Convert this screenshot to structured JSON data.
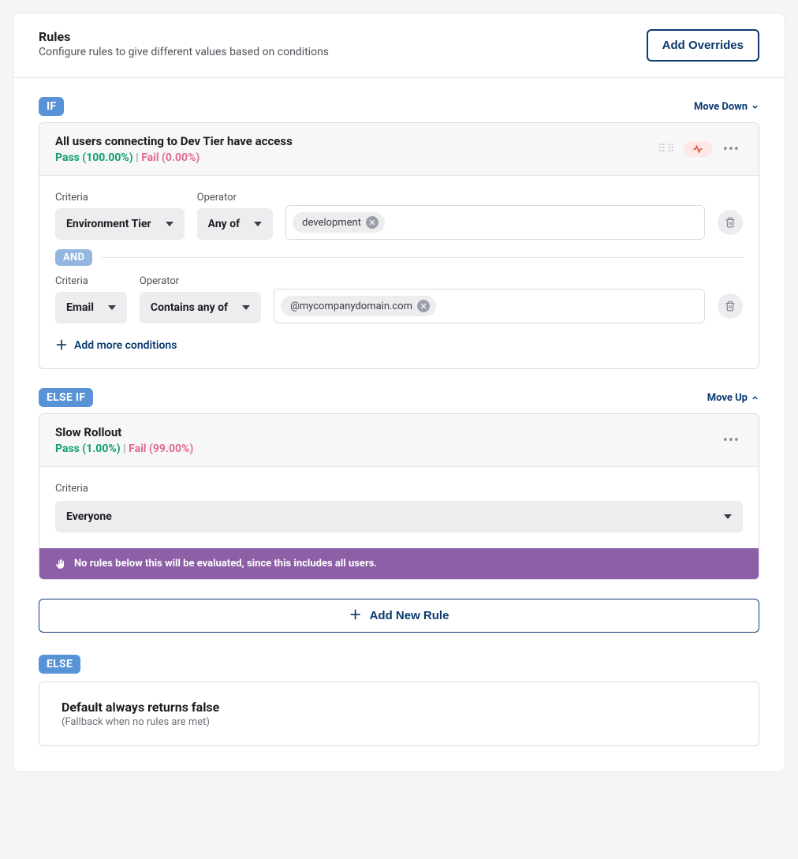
{
  "header": {
    "title": "Rules",
    "subtitle": "Configure rules to give different values based on conditions",
    "add_overrides": "Add Overrides"
  },
  "labels": {
    "if": "IF",
    "else_if": "ELSE IF",
    "else": "ELSE",
    "and": "AND",
    "criteria": "Criteria",
    "operator": "Operator",
    "move_down": "Move Down",
    "move_up": "Move Up",
    "add_more_conditions": "Add more conditions",
    "add_new_rule": "Add New Rule",
    "pass_fail_sep": " | "
  },
  "rules": [
    {
      "title": "All users connecting to Dev Tier have access",
      "pass": "Pass (100.00%)",
      "fail": "Fail (0.00%)",
      "conditions": [
        {
          "criteria": "Environment Tier",
          "operator": "Any of",
          "values": [
            "development"
          ]
        },
        {
          "criteria": "Email",
          "operator": "Contains any of",
          "values": [
            "@mycompanydomain.com"
          ]
        }
      ]
    },
    {
      "title": "Slow Rollout",
      "pass": "Pass (1.00%)",
      "fail": "Fail (99.00%)",
      "criteria_select": "Everyone",
      "warning": "No rules below this will be evaluated, since this includes all users."
    }
  ],
  "else": {
    "title": "Default always returns false",
    "subtitle": "(Fallback when no rules are met)"
  }
}
